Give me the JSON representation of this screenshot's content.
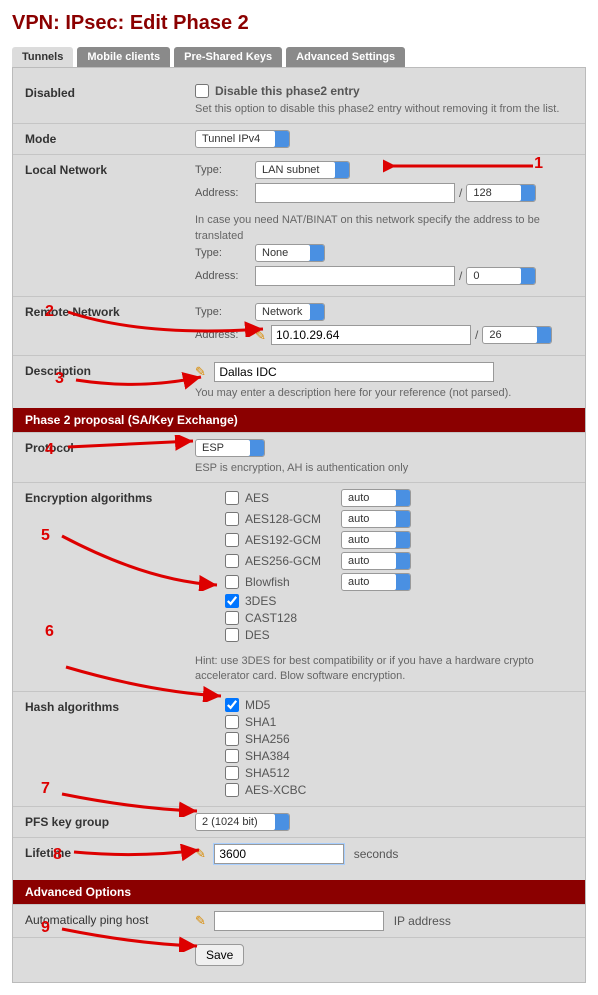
{
  "page_title": "VPN: IPsec: Edit Phase 2",
  "tabs": [
    "Tunnels",
    "Mobile clients",
    "Pre-Shared Keys",
    "Advanced Settings"
  ],
  "active_tab": 0,
  "disabled": {
    "label": "Disabled",
    "checkbox_label": "Disable this phase2 entry",
    "hint": "Set this option to disable this phase2 entry without removing it from the list."
  },
  "mode": {
    "label": "Mode",
    "value": "Tunnel IPv4"
  },
  "local_network": {
    "label": "Local Network",
    "type_label": "Type:",
    "type_value": "LAN subnet",
    "address_label": "Address:",
    "address_value": "",
    "prefix": "128",
    "nat_hint": "In case you need NAT/BINAT on this network specify the address to be translated",
    "nat_type_label": "Type:",
    "nat_type_value": "None",
    "nat_address_label": "Address:",
    "nat_address_value": "",
    "nat_prefix": "0"
  },
  "remote_network": {
    "label": "Remote Network",
    "type_label": "Type:",
    "type_value": "Network",
    "address_label": "Address:",
    "address_value": "10.10.29.64",
    "prefix": "26"
  },
  "description": {
    "label": "Description",
    "value": "Dallas IDC",
    "hint": "You may enter a description here for your reference (not parsed)."
  },
  "section1": "Phase 2 proposal (SA/Key Exchange)",
  "protocol": {
    "label": "Protocol",
    "value": "ESP",
    "hint": "ESP is encryption, AH is authentication only"
  },
  "encryption": {
    "label": "Encryption algorithms",
    "algs": [
      {
        "name": "AES",
        "checked": false,
        "keylen": "auto",
        "has_keylen": true
      },
      {
        "name": "AES128-GCM",
        "checked": false,
        "keylen": "auto",
        "has_keylen": true
      },
      {
        "name": "AES192-GCM",
        "checked": false,
        "keylen": "auto",
        "has_keylen": true
      },
      {
        "name": "AES256-GCM",
        "checked": false,
        "keylen": "auto",
        "has_keylen": true
      },
      {
        "name": "Blowfish",
        "checked": false,
        "keylen": "auto",
        "has_keylen": true
      },
      {
        "name": "3DES",
        "checked": true,
        "keylen": "",
        "has_keylen": false
      },
      {
        "name": "CAST128",
        "checked": false,
        "keylen": "",
        "has_keylen": false
      },
      {
        "name": "DES",
        "checked": false,
        "keylen": "",
        "has_keylen": false
      }
    ],
    "hint": "Hint: use 3DES for best compatibility or if you have a hardware crypto accelerator card. Blow software encryption."
  },
  "hash": {
    "label": "Hash algorithms",
    "algs": [
      {
        "name": "MD5",
        "checked": true
      },
      {
        "name": "SHA1",
        "checked": false
      },
      {
        "name": "SHA256",
        "checked": false
      },
      {
        "name": "SHA384",
        "checked": false
      },
      {
        "name": "SHA512",
        "checked": false
      },
      {
        "name": "AES-XCBC",
        "checked": false
      }
    ]
  },
  "pfs": {
    "label": "PFS key group",
    "value": "2 (1024 bit)"
  },
  "lifetime": {
    "label": "Lifetime",
    "value": "3600",
    "unit": "seconds"
  },
  "section2": "Advanced Options",
  "ping": {
    "label": "Automatically ping host",
    "value": "",
    "unit": "IP address"
  },
  "save": "Save",
  "annotations": [
    "1",
    "2",
    "3",
    "4",
    "5",
    "6",
    "7",
    "8",
    "9"
  ]
}
